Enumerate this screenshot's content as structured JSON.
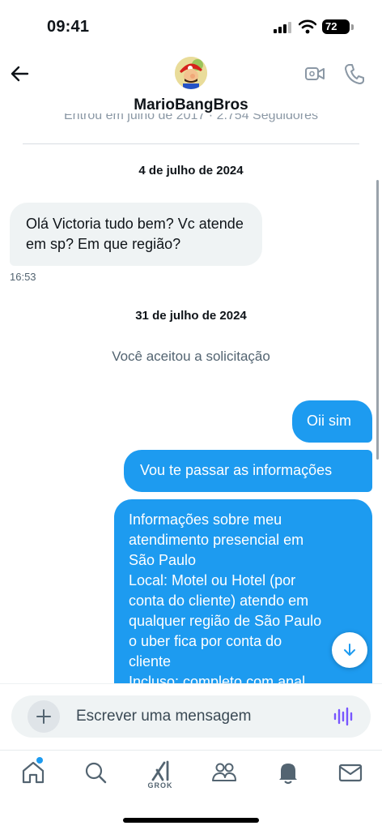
{
  "status_bar": {
    "time": "09:41",
    "battery": "72"
  },
  "header": {
    "username": "MarioBangBros",
    "subtitle": "Entrou em julho de 2017 · 2.754 Seguidores"
  },
  "messages": {
    "date1": "4 de julho de 2024",
    "incoming1": "Olá Victoria tudo bem? Vc atende em sp? Em que região?",
    "incoming1_time": "16:53",
    "date2": "31 de julho de 2024",
    "system": "Você aceitou a solicitação",
    "out1": "Oii sim",
    "out2": "Vou te passar as informações",
    "out3_lines": [
      "Informações sobre meu",
      "atendimento presencial em",
      "São Paulo",
      "Local: Motel ou Hotel (por",
      "conta do cliente) atendo em",
      "qualquer região de São Paulo",
      "o uber fica por conta do",
      "cliente",
      "Incluso: completo com anal"
    ]
  },
  "composer": {
    "placeholder": "Escrever uma mensagem"
  },
  "tabbar": {
    "grok_label": "GROK"
  },
  "icons": {
    "back": "arrow-left-icon",
    "video": "video-camera-icon",
    "call": "phone-icon",
    "plus": "plus-icon",
    "voice": "voice-waveform-icon",
    "jump": "arrow-down-icon",
    "home": "home-icon",
    "search": "search-icon",
    "grok": "grok-icon",
    "communities": "people-icon",
    "notifications": "bell-icon",
    "messages": "envelope-icon"
  },
  "colors": {
    "accent": "#1d9bf0",
    "incoming_bubble": "#eff3f4",
    "voice_icon": "#7856ff"
  }
}
